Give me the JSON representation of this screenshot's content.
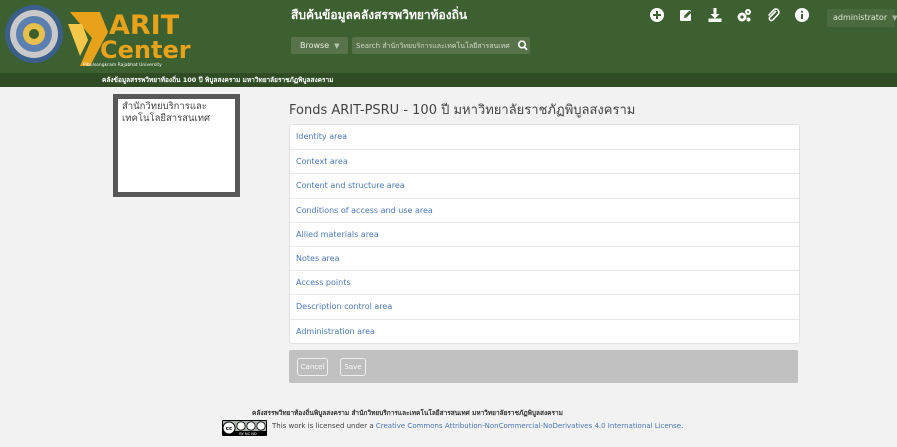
{
  "header": {
    "logo_text_top": "ARIT",
    "logo_text_bottom": "Center",
    "logo_university": "Pibulsongkram Rajabhat University",
    "site_title": "สืบค้นข้อมูลคลังสรรพวิทยาท้องถิ่น",
    "browse_label": "Browse",
    "search_placeholder": "Search สำนักวิทยบริการและเทคโนโลยีสารสนเทศ",
    "icons": [
      "plus-circle-icon",
      "edit-icon",
      "download-icon",
      "cogs-icon",
      "paperclip-icon",
      "info-icon"
    ],
    "user_label": "administrator"
  },
  "breadcrumb": "คลังข้อมูลสรรพวิทยาท้องถิ่น 100 ปี พิบูลสงคราม มหาวิทยาลัยราชภัฏพิบูลสงคราม",
  "repository": {
    "name_line1": "สำนักวิทยบริการและ",
    "name_line2": "เทคโนโลยีสารสนเทศ"
  },
  "page_title": "Fonds ARIT-PSRU - 100 ปี มหาวิทยาลัยราชภัฏพิบูลสงคราม",
  "sections": [
    "Identity area",
    "Context area",
    "Content and structure area",
    "Conditions of access and use area",
    "Allied materials area",
    "Notes area",
    "Access points",
    "Description control area",
    "Administration area"
  ],
  "actions": {
    "cancel_label": "Cancel",
    "save_label": "Save"
  },
  "footer": {
    "org_line": "คลังสรรพวิทยาท้องถิ่นพิบูลสงคราม สำนักวิทยบริการและเทคโนโลยีสารสนเทศ มหาวิทยาลัยราชภัฏพิบูลสงคราม",
    "cc_badge_text": "BY NC ND",
    "license_prefix": "This work is licensed under a ",
    "license_link": "Creative Commons Attribution-NonCommercial-NoDerivatives 4.0 International License",
    "license_suffix": "."
  },
  "colors": {
    "header_green": "#3c602f",
    "breadcrumb_green": "#2f4c25",
    "logo_gold": "#e8a21a",
    "link_blue": "#4a78b4",
    "action_bar_gray": "#c1c1c1"
  }
}
